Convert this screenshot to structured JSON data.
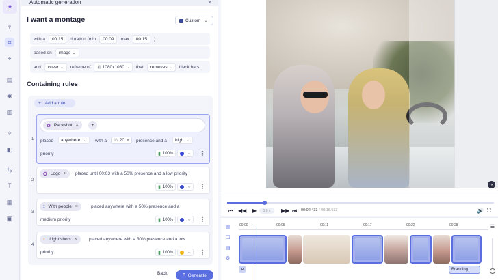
{
  "rail": {
    "icons": [
      "sparkle-icon",
      "upload-icon",
      "auto-edit-icon",
      "crop-icon",
      "subtitles-icon",
      "audio-icon",
      "chart-icon",
      "effects-icon",
      "filters-icon",
      "transitions-icon",
      "text-icon",
      "background-icon",
      "image-icon"
    ]
  },
  "panel": {
    "header_title": "Automatic generation",
    "close": "×",
    "title": "I want a montage",
    "mode_dropdown": "Custom",
    "duration_row": {
      "with_a": "with a",
      "duration_value": "00:15",
      "duration_label": "duration (min",
      "min_value": "00:09",
      "max_label": "max",
      "max_value": "00:15",
      "close_paren": ")"
    },
    "based_row": {
      "label": "based on",
      "value": "image"
    },
    "cover_row": {
      "and": "and",
      "cover": "cover",
      "reframe_label": "reframe of",
      "ratio": "1080x1080",
      "that": "that",
      "removes": "removes",
      "black_bars": "black bars"
    },
    "rules_title": "Containing rules",
    "add_rule": "Add a rule",
    "rules": [
      {
        "num": "1",
        "chip": "Packshot",
        "placed": "placed",
        "where": "anywhere",
        "with_a": "with a",
        "pct_symbol": "%",
        "pct_value": "20",
        "presence": "presence and a",
        "level": "high",
        "priority": "priority",
        "share": "100%",
        "color": "#3a4ad8"
      },
      {
        "num": "2",
        "chip": "Logo",
        "text": "placed until 00:03 with a 50% presence and a low priority",
        "share": "100%",
        "color": "#3a4ad8"
      },
      {
        "num": "3",
        "chip": "With people",
        "text": "placed anywhere with a 50% presence and a",
        "text2": "medium priority",
        "share": "100%",
        "color": "#3a4ad8"
      },
      {
        "num": "4",
        "chip": "Light shots",
        "text": "placed anywhere with a 50% presence and a low",
        "text2": "priority",
        "share": "100%",
        "color": "#f2b51c"
      }
    ],
    "back": "Back",
    "generate": "Generate"
  },
  "player": {
    "progress": 0.14,
    "speed": "1.0 x",
    "current_time": "00:02.433",
    "separator": "/",
    "total_time": "00:16.533"
  },
  "timeline": {
    "ticks": [
      "00:00",
      "00:05",
      "00:11",
      "00:17",
      "00:22",
      "00:28"
    ],
    "subtitle_marker": "R",
    "branding_label": "Branding"
  }
}
